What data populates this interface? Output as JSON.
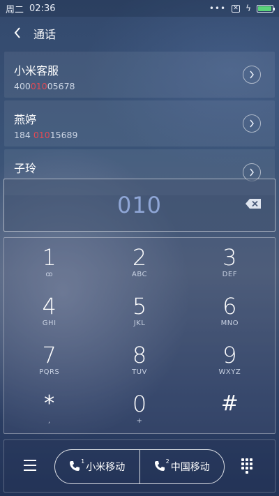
{
  "status_bar": {
    "day": "周二",
    "time": "02:36",
    "dots": "•••",
    "sim_icon": "sim-off-icon",
    "charging_icon": "bolt-icon",
    "battery_level": 0.95,
    "battery_color": "#5ad37a"
  },
  "header": {
    "title": "通话",
    "back_icon": "chevron-left-icon"
  },
  "contacts": [
    {
      "name": "小米客服",
      "number_pre": "400",
      "number_match": "010",
      "number_post": "05678"
    },
    {
      "name": "燕婷",
      "number_pre": "184 ",
      "number_match": "010",
      "number_post": "15689"
    },
    {
      "name": "子玲",
      "number_pre": "",
      "number_match": "",
      "number_post": ""
    }
  ],
  "match_color": "#e24a55",
  "dial": {
    "number": "010",
    "number_color": "#8fa6d6",
    "backspace_icon": "backspace-icon"
  },
  "keypad": {
    "keys": [
      {
        "digit": "1",
        "letters": "ꝏ"
      },
      {
        "digit": "2",
        "letters": "ABC"
      },
      {
        "digit": "3",
        "letters": "DEF"
      },
      {
        "digit": "4",
        "letters": "GHI"
      },
      {
        "digit": "5",
        "letters": "JKL"
      },
      {
        "digit": "6",
        "letters": "MNO"
      },
      {
        "digit": "7",
        "letters": "PQRS"
      },
      {
        "digit": "8",
        "letters": "TUV"
      },
      {
        "digit": "9",
        "letters": "WXYZ"
      },
      {
        "digit": "*",
        "letters": ","
      },
      {
        "digit": "0",
        "letters": "+"
      },
      {
        "digit": "#",
        "letters": ""
      }
    ]
  },
  "bottom_bar": {
    "menu_icon": "menu-icon",
    "call_sim1_label": "小米移动",
    "call_sim1_sub": "1",
    "call_sim2_label": "中国移动",
    "call_sim2_sub": "2",
    "dialpad_icon": "dialpad-icon"
  }
}
